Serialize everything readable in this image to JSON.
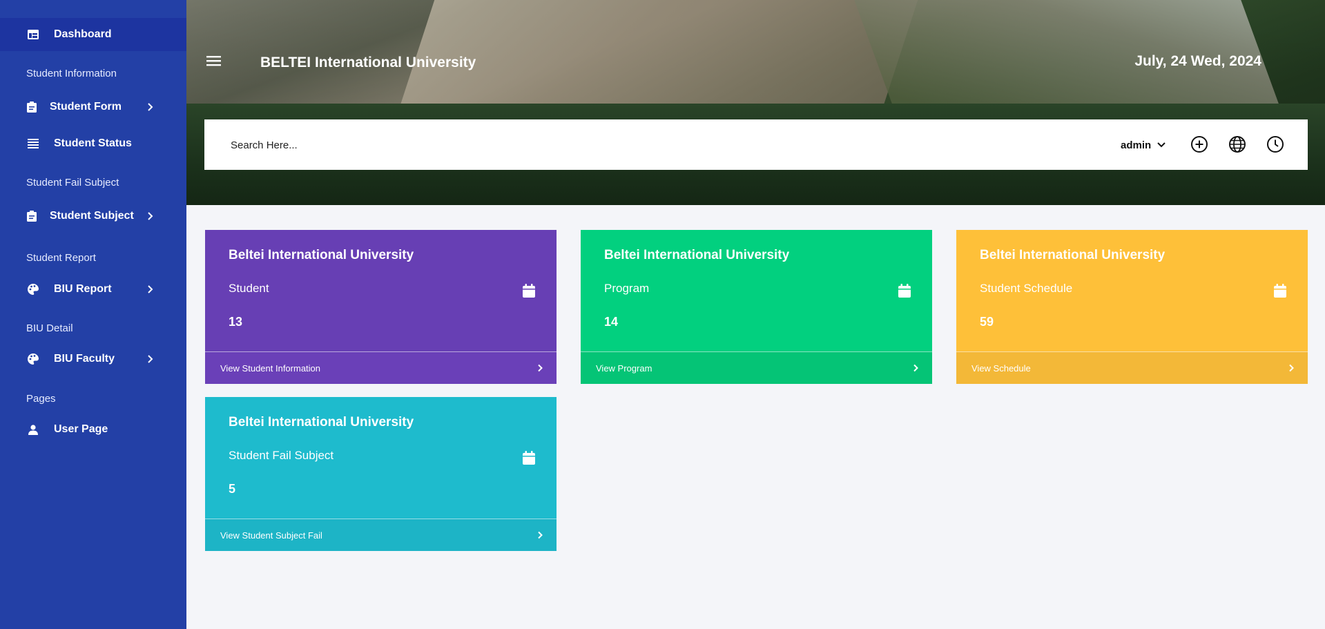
{
  "sidebar": {
    "dashboard": "Dashboard",
    "sections": {
      "student_information": "Student Information",
      "student_fail_subject": "Student Fail Subject",
      "student_report": "Student Report",
      "biu_detail": "BIU Detail",
      "pages": "Pages"
    },
    "items": {
      "student_form": "Student Form",
      "student_status": "Student Status",
      "student_subject": "Student Subject",
      "biu_report": "BIU Report",
      "biu_faculty": "BIU Faculty",
      "user_page": "User Page"
    },
    "icons": [
      "dashboard-icon",
      "clipboard-icon",
      "list-icon",
      "clipboard-icon",
      "palette-icon",
      "palette-icon",
      "user-icon"
    ]
  },
  "header": {
    "title": "BELTEI International University",
    "date": "July, 24 Wed, 2024"
  },
  "search": {
    "placeholder": "Search Here...",
    "value": ""
  },
  "toolbar": {
    "user": "admin",
    "icons": [
      "add-circle-icon",
      "globe-icon",
      "clock-icon"
    ]
  },
  "cards": [
    {
      "title": "Beltei International University",
      "label": "Student",
      "value": "13",
      "link": "View Student Information",
      "color": "#673fb4"
    },
    {
      "title": "Beltei International University",
      "label": "Program",
      "value": "14",
      "link": "View Program",
      "color": "#02d07f"
    },
    {
      "title": "Beltei International University",
      "label": "Student Schedule",
      "value": "59",
      "link": "View Schedule",
      "color": "#fec039"
    },
    {
      "title": "Beltei International University",
      "label": "Student Fail Subject",
      "value": "5",
      "link": "View Student Subject Fail",
      "color": "#1ebbcd"
    }
  ],
  "colors": {
    "sidebar": "#2340a6",
    "sidebar_active": "#1d34a0",
    "page_background": "#f4f5f9"
  }
}
